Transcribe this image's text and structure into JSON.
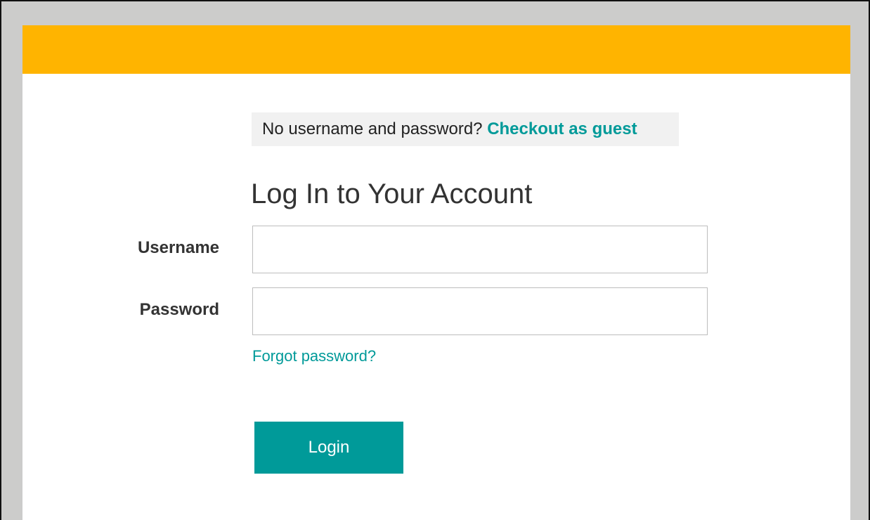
{
  "colors": {
    "header": "#ffb400",
    "accent": "#009a99",
    "frame": "#cccccb"
  },
  "guest": {
    "prompt": "No username and password?",
    "link": "Checkout as guest"
  },
  "login": {
    "title": "Log In to Your Account",
    "username_label": "Username",
    "username_value": "",
    "password_label": "Password",
    "password_value": "",
    "forgot_link": "Forgot password?",
    "button_label": "Login"
  }
}
